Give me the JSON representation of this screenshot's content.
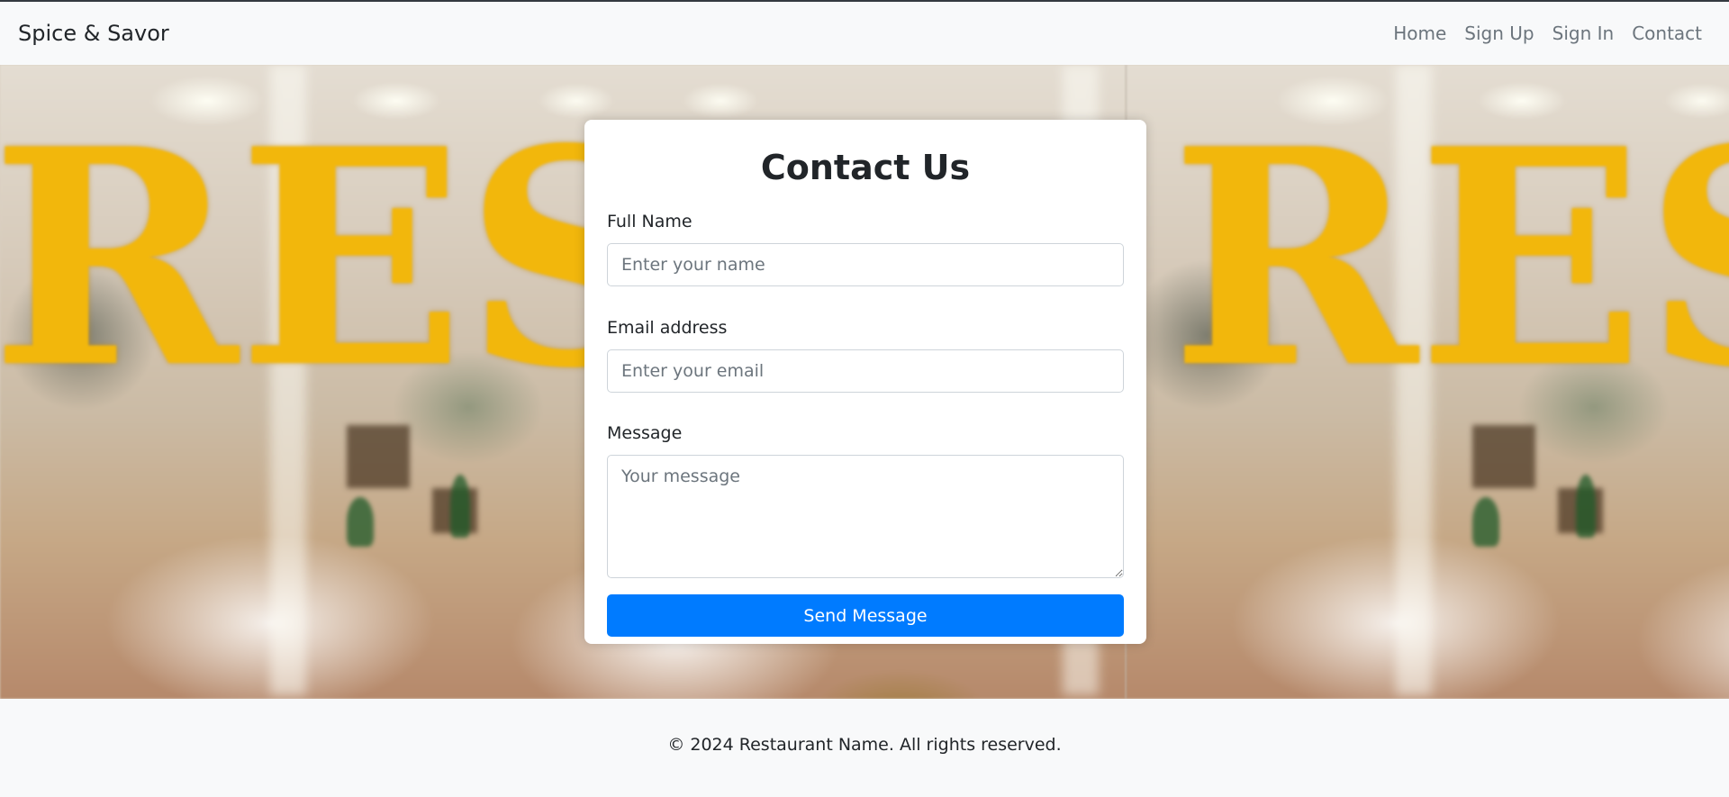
{
  "navbar": {
    "brand": "Spice & Savor",
    "links": [
      "Home",
      "Sign Up",
      "Sign In",
      "Contact"
    ]
  },
  "hero": {
    "background_sign_text": "REST"
  },
  "contact_form": {
    "title": "Contact Us",
    "fields": {
      "name": {
        "label": "Full Name",
        "placeholder": "Enter your name",
        "value": ""
      },
      "email": {
        "label": "Email address",
        "placeholder": "Enter your email",
        "value": ""
      },
      "message": {
        "label": "Message",
        "placeholder": "Your message",
        "value": ""
      }
    },
    "submit_label": "Send Message"
  },
  "footer": {
    "text": "© 2024 Restaurant Name. All rights reserved."
  },
  "colors": {
    "primary": "#007bff",
    "navbar_bg": "#f8f9fa",
    "sign_gold": "#f2b70c"
  }
}
